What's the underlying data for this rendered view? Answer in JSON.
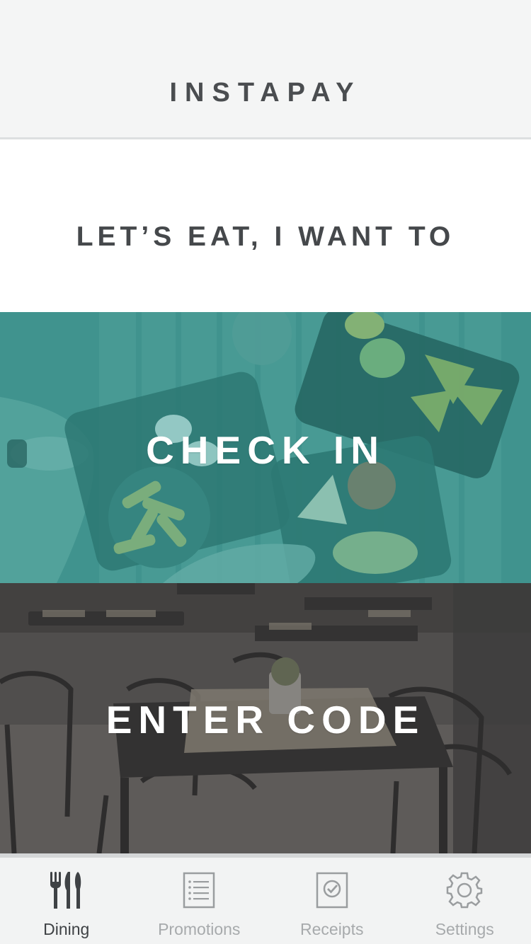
{
  "header": {
    "title": "INSTAPAY"
  },
  "prompt": {
    "text": "LET’S EAT, I WANT TO"
  },
  "actions": {
    "check_in": {
      "label": "CHECK IN",
      "overlay_color": "#2f9a93"
    },
    "enter_code": {
      "label": "ENTER CODE",
      "overlay_color": "#3a3b3d"
    }
  },
  "tabbar": {
    "tabs": [
      {
        "label": "Dining",
        "icon": "fork-knife-icon",
        "active": true
      },
      {
        "label": "Promotions",
        "icon": "list-icon",
        "active": false
      },
      {
        "label": "Receipts",
        "icon": "receipt-check-icon",
        "active": false
      },
      {
        "label": "Settings",
        "icon": "gear-icon",
        "active": false
      }
    ],
    "active_color": "#3f4245",
    "inactive_color": "#a7aaac"
  }
}
